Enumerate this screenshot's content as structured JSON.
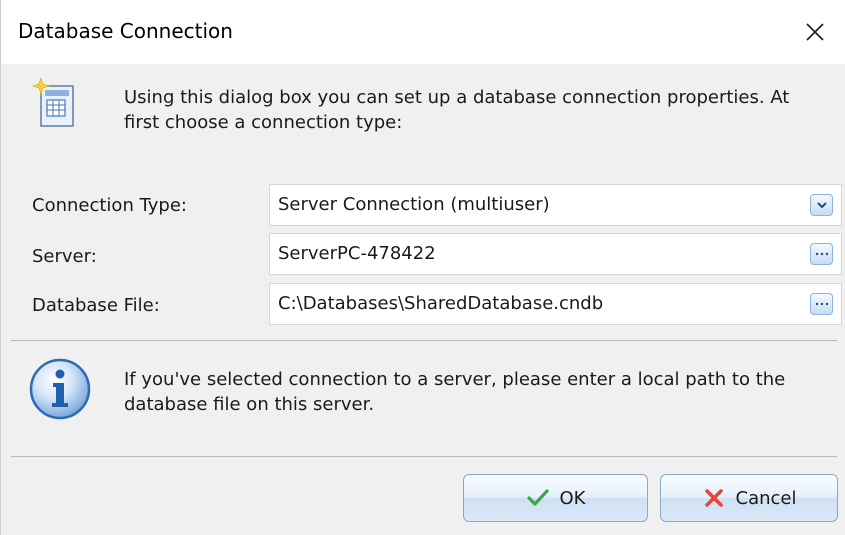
{
  "window": {
    "title": "Database Connection"
  },
  "intro": {
    "text": "Using this dialog box you can set up a database connection properties. At first choose a connection type:",
    "icon": "database-wizard-icon"
  },
  "form": {
    "connection_type": {
      "label": "Connection Type:",
      "value": "Server Connection (multiuser)"
    },
    "server": {
      "label": "Server:",
      "value": "ServerPC-478422"
    },
    "database_file": {
      "label": "Database File:",
      "value": "C:\\Databases\\SharedDatabase.cndb"
    }
  },
  "info": {
    "text": "If you've selected connection to a server, please enter a local path to the database file on this server.",
    "icon": "info-icon"
  },
  "buttons": {
    "ok_label": "OK",
    "cancel_label": "Cancel"
  },
  "colors": {
    "accent": "#3a78c4",
    "ok_check": "#3aa84a",
    "cancel_x": "#e04a3a"
  }
}
